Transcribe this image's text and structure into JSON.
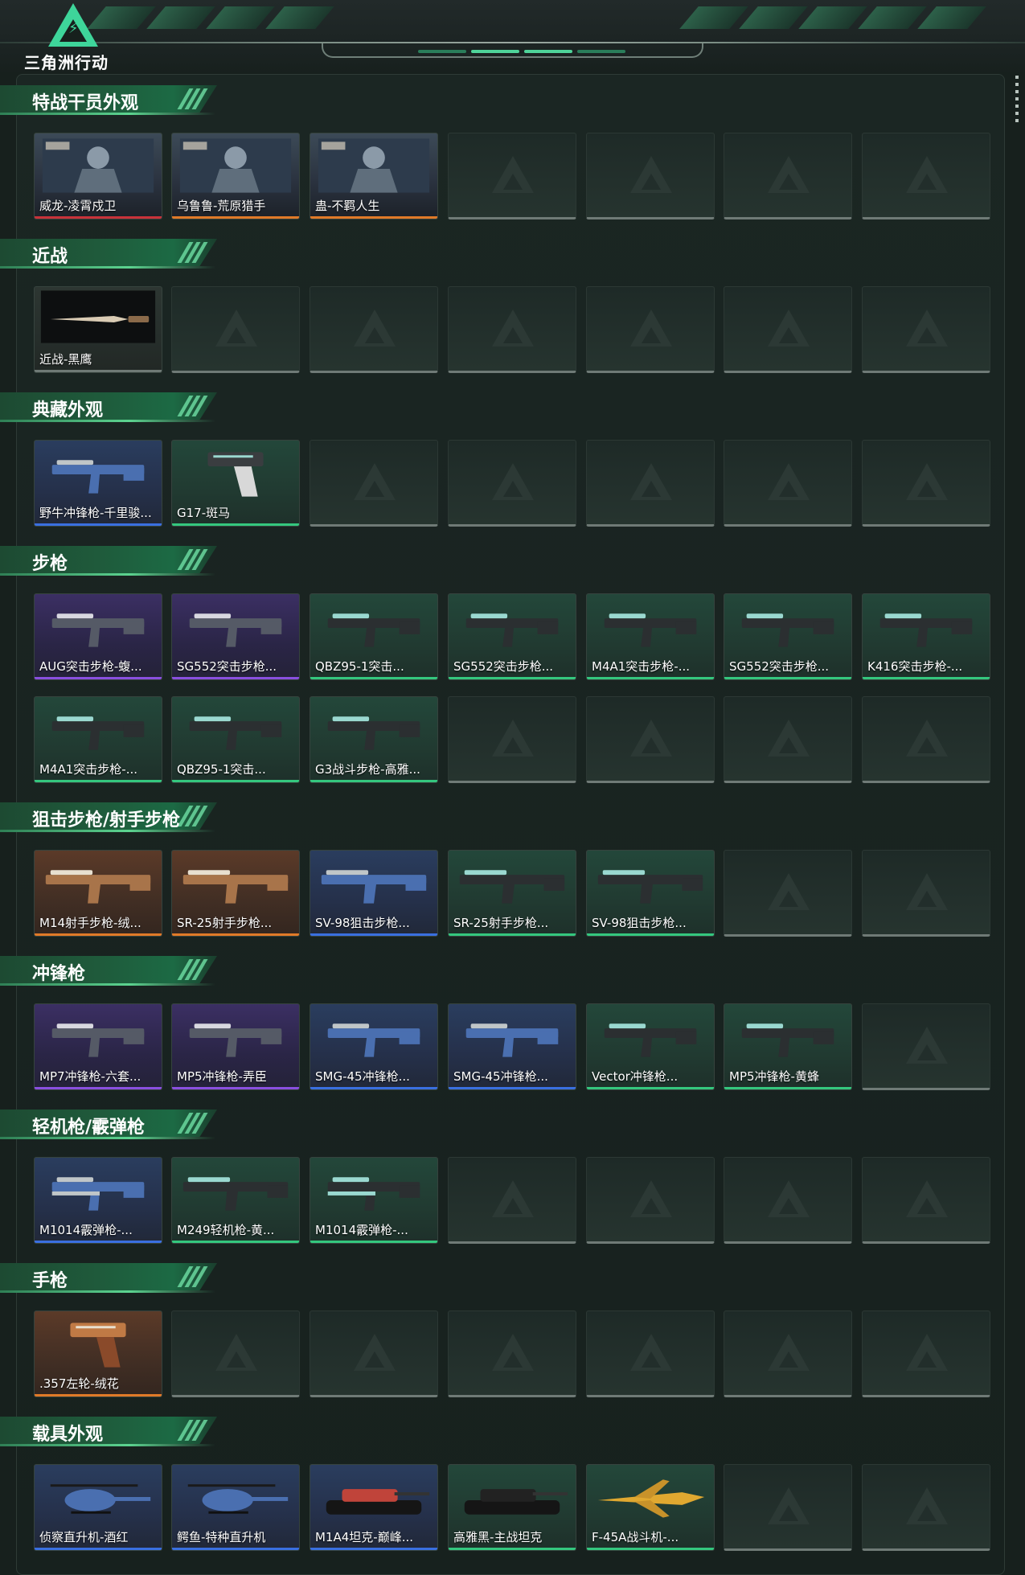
{
  "brand": {
    "name": "三角洲行动"
  },
  "colors": {
    "accent": "#3ed59a",
    "rarity_red": "#c8323a",
    "rarity_orange": "#e07a28",
    "rarity_purple": "#8a4fe0",
    "rarity_blue": "#3a6fe0",
    "rarity_green": "#34c77e",
    "rarity_none": "#6f7a76"
  },
  "sections": [
    {
      "title": "特战干员外观",
      "rows": [
        [
          {
            "label": "威龙-凌霄戍卫",
            "rarity": "red",
            "icon": "operator-skin"
          },
          {
            "label": "乌鲁鲁-荒原猎手",
            "rarity": "orange",
            "icon": "operator-skin"
          },
          {
            "label": "蛊-不羁人生",
            "rarity": "orange",
            "icon": "operator-skin"
          },
          null,
          null,
          null,
          null
        ]
      ]
    },
    {
      "title": "近战",
      "rows": [
        [
          {
            "label": "近战-黑鹰",
            "rarity": "gray",
            "icon": "knife"
          },
          null,
          null,
          null,
          null,
          null,
          null
        ]
      ]
    },
    {
      "title": "典藏外观",
      "rows": [
        [
          {
            "label": "野牛冲锋枪-千里骏...",
            "rarity": "blue",
            "icon": "smg"
          },
          {
            "label": "G17-斑马",
            "rarity": "green",
            "icon": "pistol"
          },
          null,
          null,
          null,
          null,
          null
        ]
      ]
    },
    {
      "title": "步枪",
      "rows": [
        [
          {
            "label": "AUG突击步枪-蝮...",
            "rarity": "purple",
            "icon": "rifle"
          },
          {
            "label": "SG552突击步枪...",
            "rarity": "purple",
            "icon": "rifle"
          },
          {
            "label": "QBZ95-1突击...",
            "rarity": "green",
            "icon": "rifle"
          },
          {
            "label": "SG552突击步枪...",
            "rarity": "green",
            "icon": "rifle"
          },
          {
            "label": "M4A1突击步枪-...",
            "rarity": "green",
            "icon": "rifle"
          },
          {
            "label": "SG552突击步枪...",
            "rarity": "green",
            "icon": "rifle"
          },
          {
            "label": "K416突击步枪-...",
            "rarity": "green",
            "icon": "rifle"
          }
        ],
        [
          {
            "label": "M4A1突击步枪-...",
            "rarity": "green",
            "icon": "rifle"
          },
          {
            "label": "QBZ95-1突击...",
            "rarity": "green",
            "icon": "rifle"
          },
          {
            "label": "G3战斗步枪-高雅...",
            "rarity": "green",
            "icon": "rifle"
          },
          null,
          null,
          null,
          null
        ]
      ]
    },
    {
      "title": "狙击步枪/射手步枪",
      "rows": [
        [
          {
            "label": "M14射手步枪-绒...",
            "rarity": "orange",
            "icon": "sniper"
          },
          {
            "label": "SR-25射手步枪...",
            "rarity": "orange",
            "icon": "sniper"
          },
          {
            "label": "SV-98狙击步枪...",
            "rarity": "blue",
            "icon": "sniper"
          },
          {
            "label": "SR-25射手步枪...",
            "rarity": "green",
            "icon": "sniper"
          },
          {
            "label": "SV-98狙击步枪...",
            "rarity": "green",
            "icon": "sniper"
          },
          null,
          null
        ]
      ]
    },
    {
      "title": "冲锋枪",
      "rows": [
        [
          {
            "label": "MP7冲锋枪-六套...",
            "rarity": "purple",
            "icon": "smg"
          },
          {
            "label": "MP5冲锋枪-弄臣",
            "rarity": "purple",
            "icon": "smg"
          },
          {
            "label": "SMG-45冲锋枪...",
            "rarity": "blue",
            "icon": "smg"
          },
          {
            "label": "SMG-45冲锋枪...",
            "rarity": "blue",
            "icon": "smg"
          },
          {
            "label": "Vector冲锋枪...",
            "rarity": "green",
            "icon": "smg"
          },
          {
            "label": "MP5冲锋枪-黄蜂",
            "rarity": "green",
            "icon": "smg"
          },
          null
        ]
      ]
    },
    {
      "title": "轻机枪/霰弹枪",
      "rows": [
        [
          {
            "label": "M1014霰弹枪-...",
            "rarity": "blue",
            "icon": "shotgun"
          },
          {
            "label": "M249轻机枪-黄...",
            "rarity": "green",
            "icon": "lmg"
          },
          {
            "label": "M1014霰弹枪-...",
            "rarity": "green",
            "icon": "shotgun"
          },
          null,
          null,
          null,
          null
        ]
      ]
    },
    {
      "title": "手枪",
      "rows": [
        [
          {
            "label": ".357左轮-绒花",
            "rarity": "orange",
            "icon": "revolver"
          },
          null,
          null,
          null,
          null,
          null,
          null
        ]
      ]
    },
    {
      "title": "载具外观",
      "rows": [
        [
          {
            "label": "侦察直升机-酒红",
            "rarity": "blue",
            "icon": "helicopter"
          },
          {
            "label": "鳄鱼-特种直升机",
            "rarity": "blue",
            "icon": "helicopter"
          },
          {
            "label": "M1A4坦克-巅峰...",
            "rarity": "blue",
            "icon": "tank"
          },
          {
            "label": "高雅黑-主战坦克",
            "rarity": "green",
            "icon": "tank"
          },
          {
            "label": "F-45A战斗机-...",
            "rarity": "green",
            "icon": "jet"
          },
          null,
          null
        ]
      ]
    }
  ]
}
